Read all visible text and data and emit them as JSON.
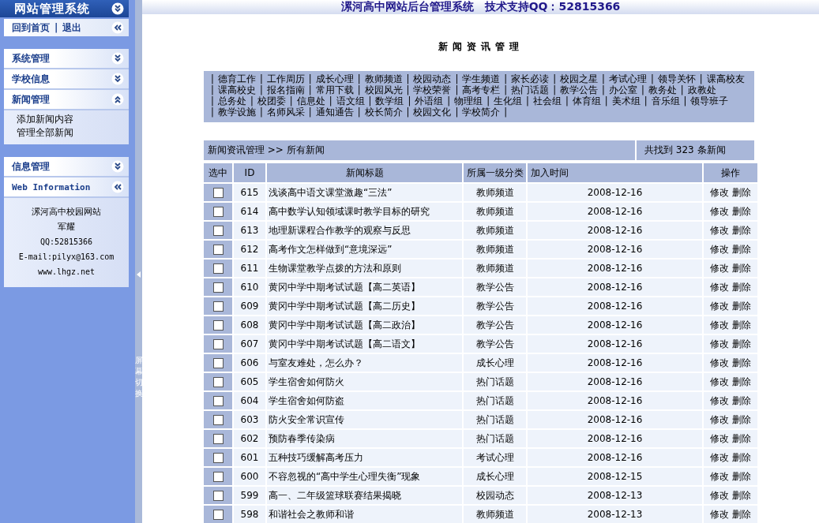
{
  "sidebar": {
    "title": "网站管理系统",
    "top_links": [
      "回到首页",
      "退出"
    ],
    "top_links_separator": "|",
    "sections": [
      {
        "title": "系统管理",
        "kind": "menu",
        "expanded": false
      },
      {
        "title": "学校信息",
        "kind": "menu",
        "expanded": false
      },
      {
        "title": "新闻管理",
        "kind": "menu",
        "expanded": true,
        "items": [
          "添加新闻内容",
          "管理全部新闻"
        ]
      },
      {
        "title": "信息管理",
        "kind": "menu",
        "expanded": false
      },
      {
        "title": "Web Information",
        "kind": "info",
        "expanded": true,
        "items": [
          "漯河高中校园网站",
          "军耀",
          "QQ:52815366",
          "E-mail:pilyx@163.com",
          "www.lhgz.net"
        ]
      }
    ]
  },
  "splitter": {
    "label": "屏幕切换"
  },
  "header": {
    "title": "漯河高中网站后台管理系统　技术支持QQ：52815366"
  },
  "page_title": "新 闻 资 讯 管 理",
  "link_separator": "|",
  "categories": [
    "德育工作",
    "工作周历",
    "成长心理",
    "教师频道",
    "校园动态",
    "学生频道",
    "家长必读",
    "校园之星",
    "考试心理",
    "领导关怀",
    "课高校友",
    "课高校史",
    "报名指南",
    "常用下载",
    "校园风光",
    "学校荣誉",
    "高考专栏",
    "热门话题",
    "教学公告",
    "办公室",
    "教务处",
    "政教处",
    "总务处",
    "校团委",
    "信息处",
    "语文组",
    "数学组",
    "外语组",
    "物理组",
    "生化组",
    "社会组",
    "体育组",
    "美术组",
    "音乐组",
    "领导班子",
    "教学设施",
    "名师风采",
    "通知通告",
    "校长简介",
    "校园文化",
    "学校简介"
  ],
  "breadcrumb": "新闻资讯管理 >> 所有新闻",
  "result_count": "共找到 323 条新闻",
  "table": {
    "columns": [
      "选中",
      "ID",
      "新闻标题",
      "所属一级分类",
      "加入时间",
      "操作"
    ],
    "rows": [
      {
        "checked": false,
        "id": "615",
        "title": "浅谈高中语文课堂激趣“三法”",
        "category": "教师频道",
        "date": "2008-12-16",
        "actions": [
          "修改",
          "删除"
        ]
      },
      {
        "checked": false,
        "id": "614",
        "title": "高中数学认知领域课时教学目标的研究",
        "category": "教师频道",
        "date": "2008-12-16",
        "actions": [
          "修改",
          "删除"
        ]
      },
      {
        "checked": false,
        "id": "613",
        "title": "地理新课程合作教学的观察与反思",
        "category": "教师频道",
        "date": "2008-12-16",
        "actions": [
          "修改",
          "删除"
        ]
      },
      {
        "checked": false,
        "id": "612",
        "title": "高考作文怎样做到“意境深远”",
        "category": "教师频道",
        "date": "2008-12-16",
        "actions": [
          "修改",
          "删除"
        ]
      },
      {
        "checked": false,
        "id": "611",
        "title": "生物课堂教学点拨的方法和原则",
        "category": "教师频道",
        "date": "2008-12-16",
        "actions": [
          "修改",
          "删除"
        ]
      },
      {
        "checked": false,
        "id": "610",
        "title": "黄冈中学中期考试试题【高二英语】",
        "category": "教学公告",
        "date": "2008-12-16",
        "actions": [
          "修改",
          "删除"
        ]
      },
      {
        "checked": false,
        "id": "609",
        "title": "黄冈中学中期考试试题【高二历史】",
        "category": "教学公告",
        "date": "2008-12-16",
        "actions": [
          "修改",
          "删除"
        ]
      },
      {
        "checked": false,
        "id": "608",
        "title": "黄冈中学中期考试试题【高二政治】",
        "category": "教学公告",
        "date": "2008-12-16",
        "actions": [
          "修改",
          "删除"
        ]
      },
      {
        "checked": false,
        "id": "607",
        "title": "黄冈中学中期考试试题【高二语文】",
        "category": "教学公告",
        "date": "2008-12-16",
        "actions": [
          "修改",
          "删除"
        ]
      },
      {
        "checked": false,
        "id": "606",
        "title": "与室友难处，怎么办？",
        "category": "成长心理",
        "date": "2008-12-16",
        "actions": [
          "修改",
          "删除"
        ]
      },
      {
        "checked": false,
        "id": "605",
        "title": "学生宿舍如何防火",
        "category": "热门话题",
        "date": "2008-12-16",
        "actions": [
          "修改",
          "删除"
        ]
      },
      {
        "checked": false,
        "id": "604",
        "title": "学生宿舍如何防盗",
        "category": "热门话题",
        "date": "2008-12-16",
        "actions": [
          "修改",
          "删除"
        ]
      },
      {
        "checked": false,
        "id": "603",
        "title": "防火安全常识宣传",
        "category": "热门话题",
        "date": "2008-12-16",
        "actions": [
          "修改",
          "删除"
        ]
      },
      {
        "checked": false,
        "id": "602",
        "title": "预防春季传染病",
        "category": "热门话题",
        "date": "2008-12-16",
        "actions": [
          "修改",
          "删除"
        ]
      },
      {
        "checked": false,
        "id": "601",
        "title": "五种技巧缓解高考压力",
        "category": "考试心理",
        "date": "2008-12-16",
        "actions": [
          "修改",
          "删除"
        ]
      },
      {
        "checked": false,
        "id": "600",
        "title": "不容忽视的“高中学生心理失衡”现象",
        "category": "成长心理",
        "date": "2008-12-15",
        "actions": [
          "修改",
          "删除"
        ]
      },
      {
        "checked": false,
        "id": "599",
        "title": "高一、二年级篮球联赛结果揭晓",
        "category": "校园动态",
        "date": "2008-12-13",
        "actions": [
          "修改",
          "删除"
        ]
      },
      {
        "checked": false,
        "id": "598",
        "title": "和谐社会之教师和谐",
        "category": "教师频道",
        "date": "2008-12-13",
        "actions": [
          "修改",
          "删除"
        ]
      }
    ]
  }
}
